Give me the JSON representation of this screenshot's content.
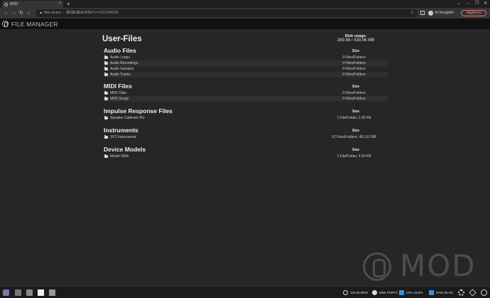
{
  "browser": {
    "tab_title": "MOD",
    "tab_close": "×",
    "new_tab": "+",
    "win_minimize": "–",
    "win_maximize": "❐",
    "win_close": "✕",
    "win_menu": "⌄",
    "back": "←",
    "forward": "→",
    "reload": "↻",
    "home": "⌂",
    "security_warning": "▲",
    "security_label": "Non sicuro",
    "url_separator": "|",
    "url_host": "10.10.10.1",
    "url_path": ":8888/?v=1521654165",
    "bookmark_star": "☆",
    "incognito_label": "In incognito",
    "update_label": "Aggiorna",
    "menu_dots": "⋮"
  },
  "app": {
    "title": "FILE MANAGER"
  },
  "page": {
    "title": "User-Files",
    "disk_label": "Disk usage:",
    "disk_value": "269.98 / 439.96 MB"
  },
  "sections": [
    {
      "title": "Audio Files",
      "size_header": "Size",
      "rows": [
        {
          "name": "Audio Loops",
          "size": "0 Files/Folders"
        },
        {
          "name": "Audio Recordings",
          "size": "0 Files/Folders"
        },
        {
          "name": "Audio Samples",
          "size": "0 Files/Folders"
        },
        {
          "name": "Audio Tracks",
          "size": "0 Files/Folders"
        }
      ]
    },
    {
      "title": "MIDI Files",
      "size_header": "Size",
      "rows": [
        {
          "name": "MIDI Clips",
          "size": "0 Files/Folders"
        },
        {
          "name": "MIDI Songs",
          "size": "0 Files/Folders"
        }
      ]
    },
    {
      "title": "Impulse Response Files",
      "size_header": "Size",
      "rows": [
        {
          "name": "Speaker Cabinets IRs",
          "size": "1 File/Folder, 2.05 KB"
        }
      ]
    },
    {
      "title": "Instruments",
      "size_header": "Size",
      "rows": [
        {
          "name": "SF2 Instruments",
          "size": "52 Files/Folders, 451.62 MB"
        }
      ]
    },
    {
      "title": "Device Models",
      "size_header": "Size",
      "rows": [
        {
          "name": "Model SIMs",
          "size": "1 File/Folder, 4.00 KB"
        }
      ]
    }
  ],
  "watermark": {
    "text": "MOD"
  },
  "statusbar": {
    "bpm": "120.00 BPM",
    "midi_ports": "MIDI PORTS",
    "cpu": "CPU 19.8%",
    "ram": "RAM 25.4%"
  },
  "colors": {
    "accent_blue": "#3a8dd8",
    "update_red": "#f28b82",
    "background": "#262626"
  }
}
